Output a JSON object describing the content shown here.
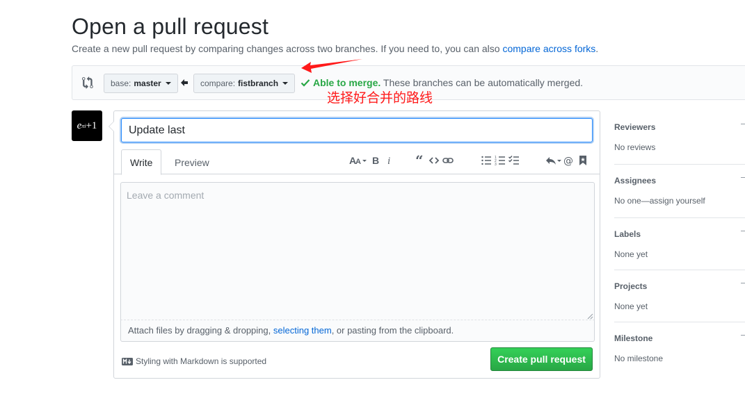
{
  "header": {
    "title": "Open a pull request",
    "subtitle_prefix": "Create a new pull request by comparing changes across two branches. If you need to, you can also ",
    "subtitle_link": "compare across forks",
    "subtitle_suffix": "."
  },
  "range": {
    "base_label": "base:",
    "base_value": "master",
    "compare_label": "compare:",
    "compare_value": "fistbranch",
    "merge_ok": "Able to merge.",
    "merge_text": " These branches can be automatically merged."
  },
  "annotation": {
    "text": "选择好合并的路线",
    "color": "#ff1a1a"
  },
  "avatar": {
    "base": "e",
    "exponent": "πi",
    "tail": "+1"
  },
  "form": {
    "title_value": "Update last",
    "tab_write": "Write",
    "tab_preview": "Preview",
    "toolbar_icons": [
      "text-size-icon",
      "bold-icon",
      "italic-icon",
      "quote-icon",
      "code-icon",
      "link-icon",
      "bulleted-list-icon",
      "numbered-list-icon",
      "task-list-icon",
      "reply-icon",
      "mention-icon",
      "bookmark-icon"
    ],
    "comment_placeholder": "Leave a comment",
    "attach_prefix": "Attach files by dragging & dropping, ",
    "attach_link": "selecting them",
    "attach_suffix": ", or pasting from the clipboard.",
    "markdown_note": "Styling with Markdown is supported",
    "create_button": "Create pull request"
  },
  "sidebar": {
    "sections": [
      {
        "heading": "Reviewers",
        "value": "No reviews"
      },
      {
        "heading": "Assignees",
        "value": "No one—assign yourself"
      },
      {
        "heading": "Labels",
        "value": "None yet"
      },
      {
        "heading": "Projects",
        "value": "None yet"
      },
      {
        "heading": "Milestone",
        "value": "No milestone"
      }
    ]
  },
  "colors": {
    "link": "#0366d6",
    "success": "#28a745",
    "text_muted": "#586069"
  }
}
